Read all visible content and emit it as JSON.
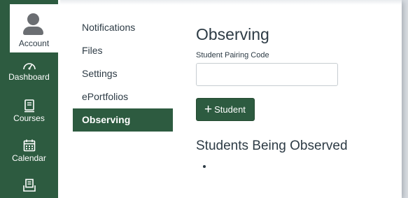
{
  "global_nav": {
    "account_label": "Account",
    "items": [
      {
        "label": "Dashboard",
        "icon": "dashboard-icon"
      },
      {
        "label": "Courses",
        "icon": "courses-icon"
      },
      {
        "label": "Calendar",
        "icon": "calendar-icon"
      },
      {
        "label": "",
        "icon": "inbox-icon"
      }
    ],
    "colors": {
      "rail": "#2d5b40",
      "accent": "#2d5b40"
    }
  },
  "sub_nav": {
    "items": [
      {
        "label": "Notifications",
        "active": false
      },
      {
        "label": "Files",
        "active": false
      },
      {
        "label": "Settings",
        "active": false
      },
      {
        "label": "ePortfolios",
        "active": false
      },
      {
        "label": "Observing",
        "active": true
      }
    ]
  },
  "main": {
    "title": "Observing",
    "pairing_code_label": "Student Pairing Code",
    "pairing_code_value": "",
    "add_button_label": "Student",
    "observed_heading": "Students Being Observed",
    "observed_students": [
      ""
    ]
  }
}
